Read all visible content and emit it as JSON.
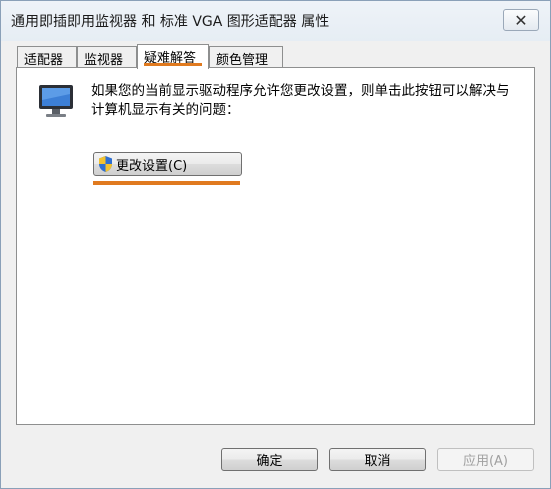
{
  "window": {
    "title": "通用即插即用监视器 和 标准 VGA 图形适配器 属性",
    "close_glyph": "✕"
  },
  "tabs": [
    {
      "label": "适配器"
    },
    {
      "label": "监视器"
    },
    {
      "label": "疑难解答",
      "active": true
    },
    {
      "label": "颜色管理"
    }
  ],
  "troubleshoot": {
    "description": "如果您的当前显示驱动程序允许您更改设置，则单击此按钮可以解决与计算机显示有关的问题：",
    "change_settings_label": "更改设置(C)"
  },
  "footer": {
    "ok_label": "确定",
    "cancel_label": "取消",
    "apply_label": "应用(A)"
  },
  "colors": {
    "highlight": "#e07a1f"
  }
}
